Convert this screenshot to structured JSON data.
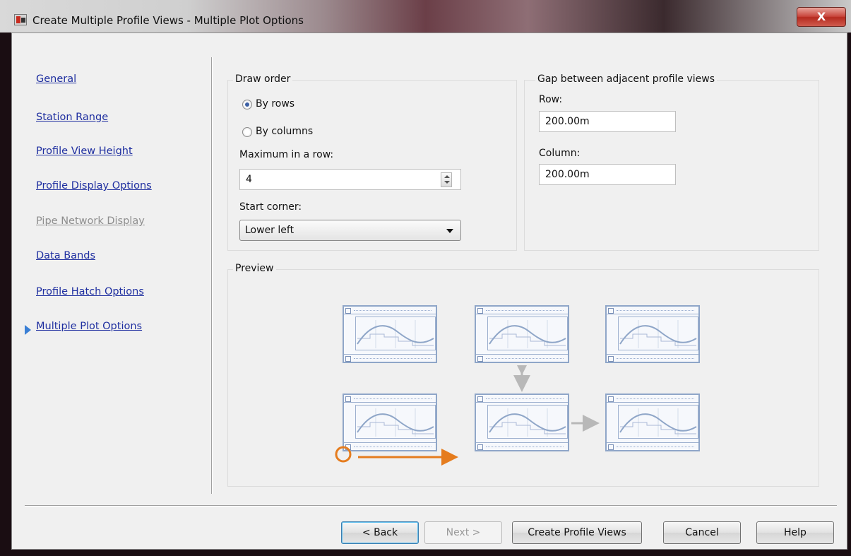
{
  "window": {
    "title": "Create Multiple Profile Views - Multiple Plot Options",
    "close_label": "X"
  },
  "nav": {
    "items": [
      {
        "label": "General",
        "enabled": true,
        "active": false
      },
      {
        "label": "Station Range",
        "enabled": true,
        "active": false
      },
      {
        "label": "Profile View Height",
        "enabled": true,
        "active": false
      },
      {
        "label": "Profile Display Options",
        "enabled": true,
        "active": false
      },
      {
        "label": "Pipe Network Display",
        "enabled": false,
        "active": false
      },
      {
        "label": "Data Bands",
        "enabled": true,
        "active": false
      },
      {
        "label": "Profile Hatch Options",
        "enabled": true,
        "active": false
      },
      {
        "label": "Multiple Plot Options",
        "enabled": true,
        "active": true
      }
    ]
  },
  "draw_order": {
    "group_label": "Draw order",
    "by_rows_label": "By rows",
    "by_columns_label": "By columns",
    "selected": "By rows",
    "max_in_row_label": "Maximum in a row:",
    "max_in_row_value": "4",
    "start_corner_label": "Start corner:",
    "start_corner_value": "Lower left"
  },
  "gap": {
    "group_label": "Gap between adjacent profile views",
    "row_label": "Row:",
    "row_value": "200.00m",
    "column_label": "Column:",
    "column_value": "200.00m"
  },
  "preview": {
    "group_label": "Preview"
  },
  "buttons": {
    "back": "< Back",
    "next": "Next >",
    "create": "Create Profile Views",
    "cancel": "Cancel",
    "help": "Help"
  },
  "colors": {
    "link": "#1f2fa0",
    "accent_orange": "#e57c1e",
    "thumbnail_blue": "#8fa6c8"
  }
}
